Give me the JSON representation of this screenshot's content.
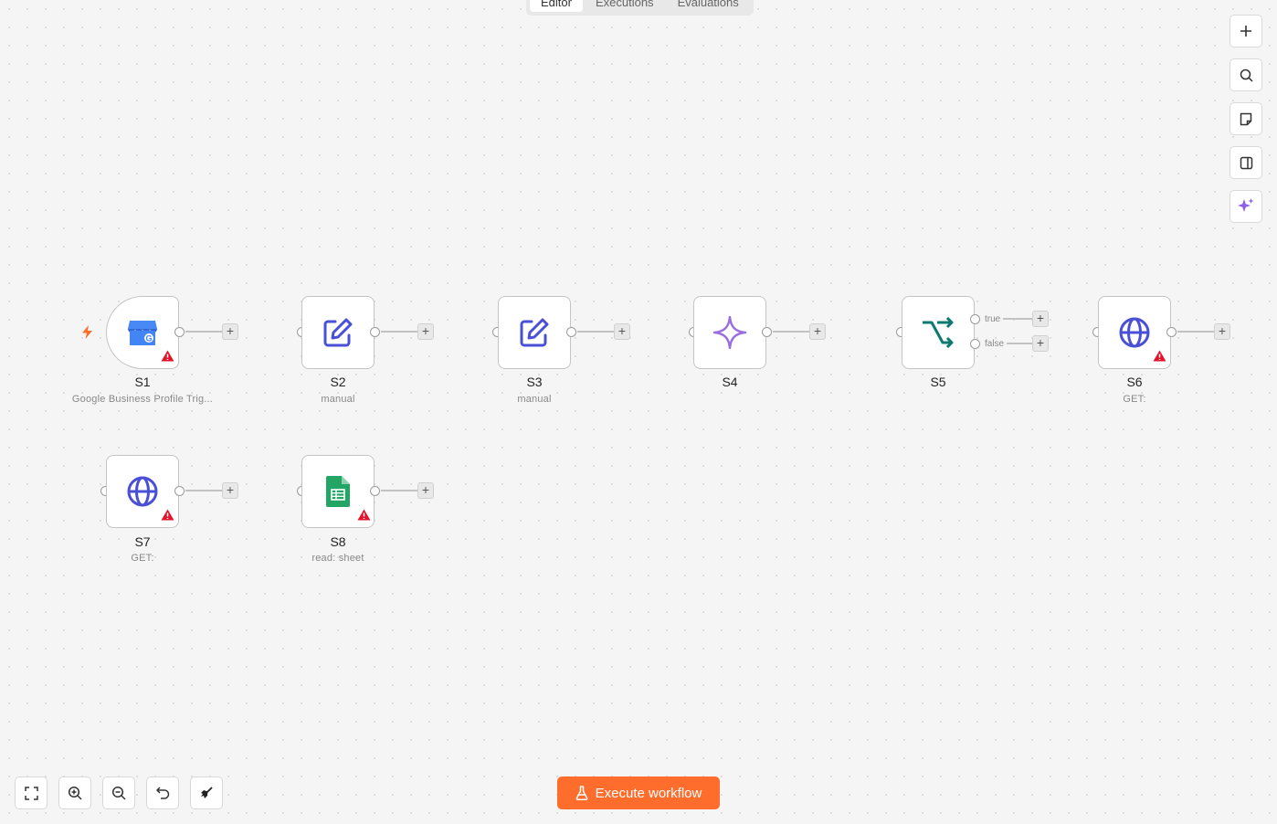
{
  "tabs": [
    {
      "label": "Editor",
      "active": true
    },
    {
      "label": "Executions",
      "active": false
    },
    {
      "label": "Evaluations",
      "active": false
    }
  ],
  "right_toolbar": [
    "plus-icon",
    "search-icon",
    "sticky-note-icon",
    "panel-toggle-icon",
    "ai-sparkle-icon"
  ],
  "bottom_toolbar": [
    "fit-view-icon",
    "zoom-in-icon",
    "zoom-out-icon",
    "undo-icon",
    "tidy-up-icon"
  ],
  "nodes": [
    {
      "name": "S1",
      "subtitle": "Google Business Profile Trig...",
      "icon": "google-business-icon",
      "warning": true,
      "trigger": true
    },
    {
      "name": "S2",
      "subtitle": "manual",
      "icon": "edit-icon",
      "warning": false
    },
    {
      "name": "S3",
      "subtitle": "manual",
      "icon": "edit-icon",
      "warning": false
    },
    {
      "name": "S4",
      "subtitle": "",
      "icon": "sparkle-icon",
      "warning": false
    },
    {
      "name": "S5",
      "subtitle": "",
      "icon": "if-branch-icon",
      "warning": false,
      "branches": [
        "true",
        "false"
      ]
    },
    {
      "name": "S6",
      "subtitle": "GET:",
      "icon": "globe-icon",
      "warning": true
    },
    {
      "name": "S7",
      "subtitle": "GET:",
      "icon": "globe-icon",
      "warning": true
    },
    {
      "name": "S8",
      "subtitle": "read: sheet",
      "icon": "google-sheets-icon",
      "warning": true
    }
  ],
  "execute_button": {
    "label": "Execute workflow",
    "icon": "flask-icon"
  },
  "colors": {
    "accent": "#ff6d2c",
    "node_icon": "#4a50d6",
    "if_icon": "#0c7a6e",
    "sparkle": "#9b6fe0",
    "warning": "#e4132c",
    "sheets": "#23a566"
  }
}
